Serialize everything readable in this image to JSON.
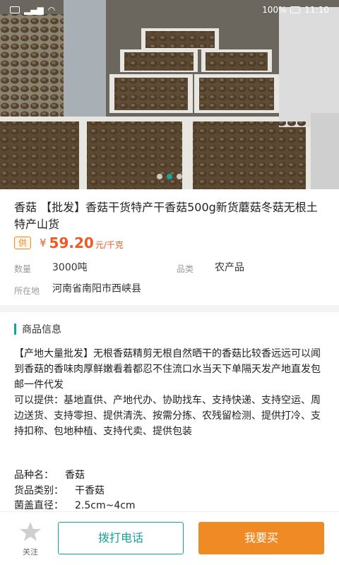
{
  "status_bar": {
    "battery": "100%",
    "time": "11:10"
  },
  "carousel": {
    "image_label": "dried-mushrooms-photo",
    "dots": 3,
    "active_index": 1
  },
  "product": {
    "title": "香菇 【批发】香菇干货特产干香菇500g新货蘑菇冬菇无根土特产山货",
    "supply_badge": "供",
    "price_currency": "¥",
    "price_value": "59.20",
    "price_unit": "元/千克",
    "quantity_label": "数量",
    "quantity_value": "3000吨",
    "category_label": "品类",
    "category_value": "农产品",
    "location_label": "所在地",
    "location_value": "河南省南阳市西峡县"
  },
  "section": {
    "title": "商品信息",
    "desc_1": "【产地大量批发】无根香菇精剪无根自然晒干的香菇比较香远远可以闻到香菇的香味肉厚鲜嫩看着都忍不住流口水当天下单隔天发产地直发包邮一件代发",
    "desc_2": "可以提供：基地直供、产地代办、协助找车、支持快递、支持空运、周边送货、支持零担、提供清洗、按需分拣、农残留检测、提供打冷、支持扣称、包地种植、支持代卖、提供包装"
  },
  "specs": [
    {
      "label": "品种名：",
      "value": "香菇"
    },
    {
      "label": "货品类别：",
      "value": "干香菇"
    },
    {
      "label": "菌盖直径：",
      "value": "2.5cm~4cm"
    }
  ],
  "bottom_bar": {
    "favorite_label": "关注",
    "call_label": "拨打电话",
    "buy_label": "我要买"
  },
  "colors": {
    "accent": "#17a39b",
    "price": "#ee5a24",
    "buy": "#f08a24"
  }
}
